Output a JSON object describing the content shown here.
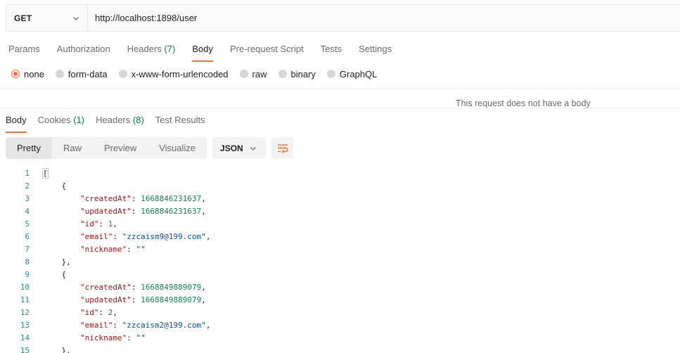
{
  "request": {
    "method": "GET",
    "url": "http://localhost:1898/user"
  },
  "request_tabs": [
    {
      "label": "Params",
      "count": ""
    },
    {
      "label": "Authorization",
      "count": ""
    },
    {
      "label": "Headers",
      "count": "(7)"
    },
    {
      "label": "Body",
      "count": "",
      "active": true
    },
    {
      "label": "Pre-request Script",
      "count": ""
    },
    {
      "label": "Tests",
      "count": ""
    },
    {
      "label": "Settings",
      "count": ""
    }
  ],
  "body_types": [
    {
      "label": "none",
      "selected": true
    },
    {
      "label": "form-data"
    },
    {
      "label": "x-www-form-urlencoded"
    },
    {
      "label": "raw"
    },
    {
      "label": "binary"
    },
    {
      "label": "GraphQL"
    }
  ],
  "no_body_message": "This request does not have a body",
  "response_tabs": [
    {
      "label": "Body",
      "count": "",
      "active": true
    },
    {
      "label": "Cookies",
      "count": "(1)"
    },
    {
      "label": "Headers",
      "count": "(8)"
    },
    {
      "label": "Test Results",
      "count": ""
    }
  ],
  "view_modes": [
    {
      "label": "Pretty",
      "active": true
    },
    {
      "label": "Raw"
    },
    {
      "label": "Preview"
    },
    {
      "label": "Visualize"
    }
  ],
  "format": "JSON",
  "icons": {
    "method_dropdown": "chevron-down-icon",
    "format_dropdown": "chevron-down-icon",
    "wrap": "wrap-lines-icon"
  },
  "colors": {
    "accent": "#ff6c37",
    "count_green": "#0a7d3e",
    "json_key": "#a31515",
    "json_number": "#098658",
    "json_string": "#0451a5"
  },
  "code_lines": [
    {
      "n": "1",
      "indent": "",
      "tokens": [
        {
          "t": "p",
          "v": "["
        }
      ]
    },
    {
      "n": "2",
      "indent": "    ",
      "tokens": [
        {
          "t": "p",
          "v": "{"
        }
      ]
    },
    {
      "n": "3",
      "indent": "        ",
      "tokens": [
        {
          "t": "k",
          "v": "\"createdAt\""
        },
        {
          "t": "p",
          "v": ": "
        },
        {
          "t": "n",
          "v": "1668846231637"
        },
        {
          "t": "p",
          "v": ","
        }
      ]
    },
    {
      "n": "4",
      "indent": "        ",
      "tokens": [
        {
          "t": "k",
          "v": "\"updatedAt\""
        },
        {
          "t": "p",
          "v": ": "
        },
        {
          "t": "n",
          "v": "1668846231637"
        },
        {
          "t": "p",
          "v": ","
        }
      ]
    },
    {
      "n": "5",
      "indent": "        ",
      "tokens": [
        {
          "t": "k",
          "v": "\"id\""
        },
        {
          "t": "p",
          "v": ": "
        },
        {
          "t": "n",
          "v": "1"
        },
        {
          "t": "p",
          "v": ","
        }
      ]
    },
    {
      "n": "6",
      "indent": "        ",
      "tokens": [
        {
          "t": "k",
          "v": "\"email\""
        },
        {
          "t": "p",
          "v": ": "
        },
        {
          "t": "s",
          "v": "\"zzcaism9@199.com\""
        },
        {
          "t": "p",
          "v": ","
        }
      ]
    },
    {
      "n": "7",
      "indent": "        ",
      "tokens": [
        {
          "t": "k",
          "v": "\"nickname\""
        },
        {
          "t": "p",
          "v": ": "
        },
        {
          "t": "s",
          "v": "\"\""
        }
      ]
    },
    {
      "n": "8",
      "indent": "    ",
      "tokens": [
        {
          "t": "p",
          "v": "},"
        }
      ]
    },
    {
      "n": "9",
      "indent": "    ",
      "tokens": [
        {
          "t": "p",
          "v": "{"
        }
      ]
    },
    {
      "n": "10",
      "indent": "        ",
      "tokens": [
        {
          "t": "k",
          "v": "\"createdAt\""
        },
        {
          "t": "p",
          "v": ": "
        },
        {
          "t": "n",
          "v": "1668849889079"
        },
        {
          "t": "p",
          "v": ","
        }
      ]
    },
    {
      "n": "11",
      "indent": "        ",
      "tokens": [
        {
          "t": "k",
          "v": "\"updatedAt\""
        },
        {
          "t": "p",
          "v": ": "
        },
        {
          "t": "n",
          "v": "1668849889079"
        },
        {
          "t": "p",
          "v": ","
        }
      ]
    },
    {
      "n": "12",
      "indent": "        ",
      "tokens": [
        {
          "t": "k",
          "v": "\"id\""
        },
        {
          "t": "p",
          "v": ": "
        },
        {
          "t": "n",
          "v": "2"
        },
        {
          "t": "p",
          "v": ","
        }
      ]
    },
    {
      "n": "13",
      "indent": "        ",
      "tokens": [
        {
          "t": "k",
          "v": "\"email\""
        },
        {
          "t": "p",
          "v": ": "
        },
        {
          "t": "s",
          "v": "\"zzcaism2@199.com\""
        },
        {
          "t": "p",
          "v": ","
        }
      ]
    },
    {
      "n": "14",
      "indent": "        ",
      "tokens": [
        {
          "t": "k",
          "v": "\"nickname\""
        },
        {
          "t": "p",
          "v": ": "
        },
        {
          "t": "s",
          "v": "\"\""
        }
      ]
    },
    {
      "n": "15",
      "indent": "    ",
      "tokens": [
        {
          "t": "p",
          "v": "},"
        }
      ]
    }
  ]
}
